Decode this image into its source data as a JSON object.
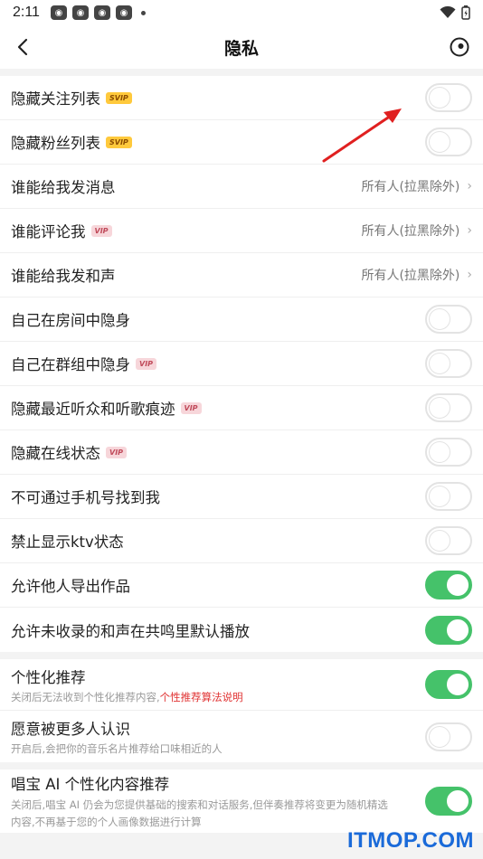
{
  "status": {
    "time": "2:11"
  },
  "header": {
    "title": "隐私"
  },
  "group1": [
    {
      "label": "隐藏关注列表",
      "badge": "SVIP",
      "type": "toggle",
      "on": false
    },
    {
      "label": "隐藏粉丝列表",
      "badge": "SVIP",
      "type": "toggle",
      "on": false
    },
    {
      "label": "谁能给我发消息",
      "type": "value",
      "value": "所有人(拉黑除外)"
    },
    {
      "label": "谁能评论我",
      "badge": "VIP",
      "type": "value",
      "value": "所有人(拉黑除外)"
    },
    {
      "label": "谁能给我发和声",
      "type": "value",
      "value": "所有人(拉黑除外)"
    },
    {
      "label": "自己在房间中隐身",
      "type": "toggle",
      "on": false
    },
    {
      "label": "自己在群组中隐身",
      "badge": "VIP",
      "type": "toggle",
      "on": false
    },
    {
      "label": "隐藏最近听众和听歌痕迹",
      "badge": "VIP",
      "type": "toggle",
      "on": false
    },
    {
      "label": "隐藏在线状态",
      "badge": "VIP",
      "type": "toggle",
      "on": false
    },
    {
      "label": "不可通过手机号找到我",
      "type": "toggle",
      "on": false
    },
    {
      "label": "禁止显示ktv状态",
      "type": "toggle",
      "on": false
    },
    {
      "label": "允许他人导出作品",
      "type": "toggle",
      "on": true
    },
    {
      "label": "允许未收录的和声在共鸣里默认播放",
      "type": "toggle",
      "on": true
    }
  ],
  "group2": [
    {
      "label": "个性化推荐",
      "sub": "关闭后无法收到个性化推荐内容,",
      "sub_link": "个性推荐算法说明",
      "on": true
    },
    {
      "label": "愿意被更多人认识",
      "sub": "开启后,会把你的音乐名片推荐给口味相近的人",
      "on": false
    }
  ],
  "group3": [
    {
      "label": "唱宝 AI 个性化内容推荐",
      "sub": "关闭后,唱宝 AI 仍会为您提供基础的搜索和对话服务,但伴奏推荐将变更为随机精选内容,不再基于您的个人画像数据进行计算",
      "on": true
    }
  ],
  "watermark": "ITMOP.COM",
  "colors": {
    "toggle_on": "#45c26a",
    "link": "#e03232",
    "watermark": "#1a6ad9"
  }
}
